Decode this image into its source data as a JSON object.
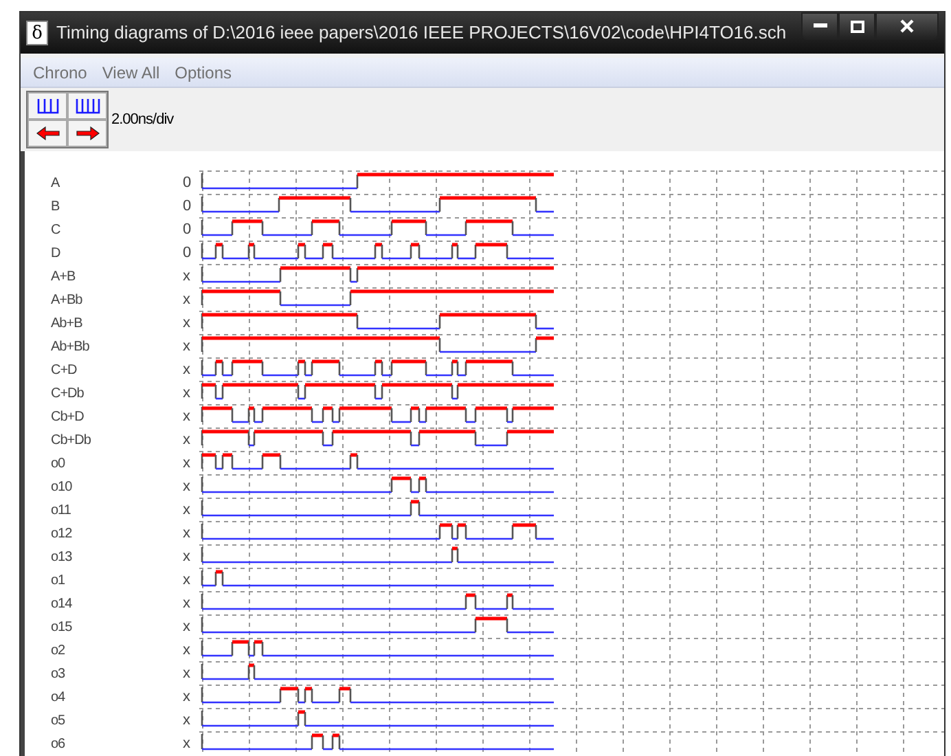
{
  "window": {
    "icon": "δ",
    "title": "Timing diagrams of D:\\2016 ieee papers\\2016 IEEE PROJECTS\\16V02\\code\\HPI4TO16.sch"
  },
  "menu": [
    "Chrono",
    "View All",
    "Options"
  ],
  "toolbar": {
    "scale": "2.00ns/div"
  },
  "signals": [
    {
      "name": "A",
      "value": "0"
    },
    {
      "name": "B",
      "value": "0"
    },
    {
      "name": "C",
      "value": "0"
    },
    {
      "name": "D",
      "value": "0"
    },
    {
      "name": "A+B",
      "value": "x"
    },
    {
      "name": "A+Bb",
      "value": "x"
    },
    {
      "name": "Ab+B",
      "value": "x"
    },
    {
      "name": "Ab+Bb",
      "value": "x"
    },
    {
      "name": "C+D",
      "value": "x"
    },
    {
      "name": "C+Db",
      "value": "x"
    },
    {
      "name": "Cb+D",
      "value": "x"
    },
    {
      "name": "Cb+Db",
      "value": "x"
    },
    {
      "name": "o0",
      "value": "x"
    },
    {
      "name": "o10",
      "value": "x"
    },
    {
      "name": "o11",
      "value": "x"
    },
    {
      "name": "o12",
      "value": "x"
    },
    {
      "name": "o13",
      "value": "x"
    },
    {
      "name": "o1",
      "value": "x"
    },
    {
      "name": "o14",
      "value": "x"
    },
    {
      "name": "o15",
      "value": "x"
    },
    {
      "name": "o2",
      "value": "x"
    },
    {
      "name": "o3",
      "value": "x"
    },
    {
      "name": "o4",
      "value": "x"
    },
    {
      "name": "o5",
      "value": "x"
    },
    {
      "name": "o6",
      "value": "x"
    }
  ]
}
